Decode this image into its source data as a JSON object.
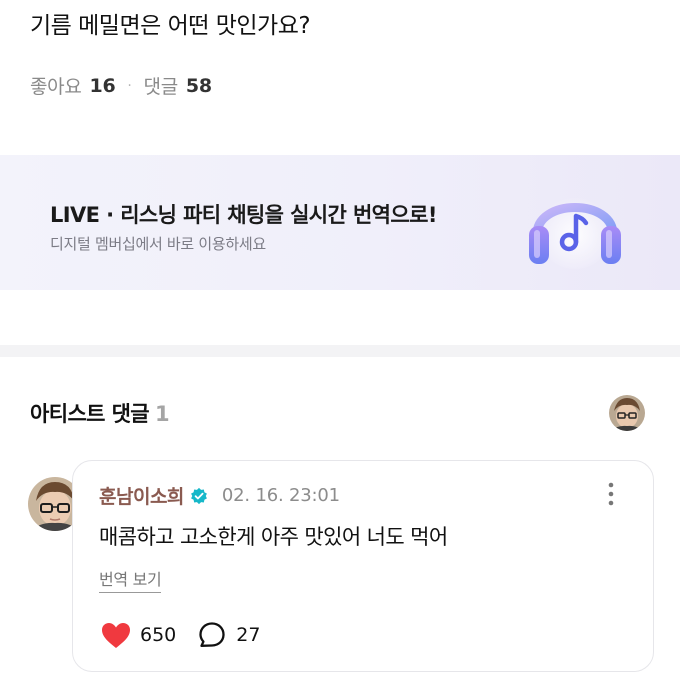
{
  "post": {
    "title": "기름 메밀면은 어떤 맛인가요?",
    "likes_label": "좋아요",
    "likes_count": "16",
    "separator": "·",
    "comments_label": "댓글",
    "comments_count": "58"
  },
  "banner": {
    "title": "LIVE · 리스닝 파티 채팅을 실시간 번역으로!",
    "subtitle": "디지털 멤버십에서 바로 이용하세요",
    "icon": "headphone-music-icon"
  },
  "artist_comments": {
    "title": "아티스트 댓글",
    "count": "1"
  },
  "comment": {
    "author": "훈남이소희",
    "verified_icon": "verified-badge-icon",
    "timestamp": "02. 16. 23:01",
    "text": "매콤하고 고소한게 아주 맛있어 너도 먹어",
    "translate_label": "번역 보기",
    "like_count": "650",
    "reply_count": "27"
  },
  "colors": {
    "author": "#8a5a50",
    "heart": "#f0393f",
    "verified": "#16b8c9",
    "banner_bg": "#f0effa"
  }
}
